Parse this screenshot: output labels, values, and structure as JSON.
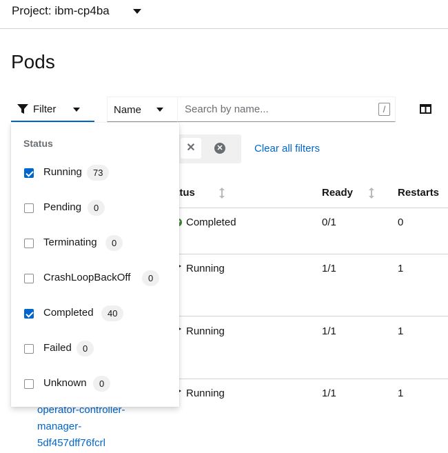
{
  "project": {
    "label": "Project: ibm-cp4ba"
  },
  "page": {
    "title": "Pods"
  },
  "toolbar": {
    "filter_label": "Filter",
    "name_select_label": "Name",
    "search_placeholder": "Search by name...",
    "search_shortcut": "/",
    "clear_all_label": "Clear all filters",
    "chip_close": "✕",
    "group_close": "✕"
  },
  "table": {
    "headers": {
      "status": "Status",
      "ready": "Ready",
      "restarts": "Restarts"
    },
    "rows": [
      {
        "status": "Completed",
        "ready": "0/1",
        "restarts": "0"
      },
      {
        "status": "Running",
        "ready": "1/1",
        "restarts": "1"
      },
      {
        "status": "Running",
        "ready": "1/1",
        "restarts": "1"
      },
      {
        "status": "Running",
        "ready": "1/1",
        "restarts": "1"
      }
    ],
    "partial_pod_name": [
      "operator-controller-",
      "manager-",
      "5df457dff76fcrl"
    ]
  },
  "filter_menu": {
    "group_title": "Status",
    "items": [
      {
        "label": "Running",
        "count": "73",
        "checked": true
      },
      {
        "label": "Pending",
        "count": "0",
        "checked": false
      },
      {
        "label": "Terminating",
        "count": "0",
        "checked": false
      },
      {
        "label": "CrashLoopBackOff",
        "count": "0",
        "checked": false
      },
      {
        "label": "Completed",
        "count": "40",
        "checked": true
      },
      {
        "label": "Failed",
        "count": "0",
        "checked": false
      },
      {
        "label": "Unknown",
        "count": "0",
        "checked": false
      }
    ]
  },
  "colors": {
    "link": "#0066cc",
    "completed_green": "#3e8635",
    "checkbox_blue": "#0066cc"
  }
}
